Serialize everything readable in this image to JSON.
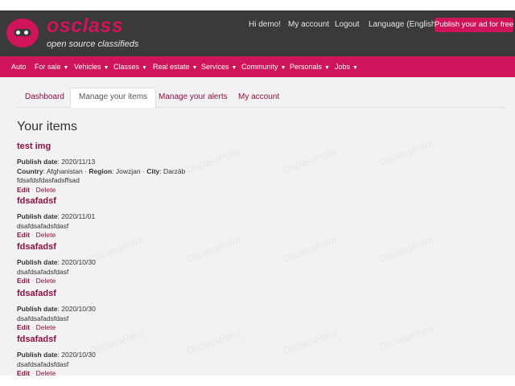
{
  "brand": {
    "name": "osclass",
    "tagline": "open source classifieds"
  },
  "top_links": {
    "greeting": "Hi demo!",
    "my_account": "My account",
    "logout": "Logout",
    "language": "Language (English)",
    "publish": "Publish your ad for free"
  },
  "nav": {
    "items": [
      {
        "label": "Auto",
        "dropdown": false
      },
      {
        "label": "For sale",
        "dropdown": true
      },
      {
        "label": "Vehicles",
        "dropdown": true
      },
      {
        "label": "Classes",
        "dropdown": true
      },
      {
        "label": "Real estate",
        "dropdown": true
      },
      {
        "label": "Services",
        "dropdown": true
      },
      {
        "label": "Community",
        "dropdown": true
      },
      {
        "label": "Personals",
        "dropdown": true
      },
      {
        "label": "Jobs",
        "dropdown": true
      }
    ]
  },
  "tabs": {
    "dashboard": "Dashboard",
    "manage_items": "Manage your items",
    "manage_alerts": "Manage your alerts",
    "my_account": "My account"
  },
  "page_title": "Your items",
  "labels": {
    "publish_date": "Publish date",
    "country": "Country",
    "region": "Region",
    "city": "City",
    "edit": "Edit",
    "delete": "Delete",
    "separator": "·"
  },
  "items": [
    {
      "title": "test img",
      "date": ": 2020/11/13",
      "country": ": Afghanistan",
      "region": ": Jowzjan",
      "city": ": Darzāb",
      "description": "fdsafdsfdasfadsffsad"
    },
    {
      "title": "fdsafadsf",
      "date": ": 2020/11/01",
      "description": "dsafdsafadsfdasf"
    },
    {
      "title": "fdsafadsf",
      "date": ": 2020/10/30",
      "description": "dsafdsafadsfdasf"
    },
    {
      "title": "fdsafadsf",
      "date": ": 2020/10/30",
      "description": "dsafdsafadsfdasf"
    },
    {
      "title": "fdsafadsf",
      "date": ": 2020/10/30",
      "description": "dsafdsafadsfdasf"
    }
  ],
  "watermark": "OsclassPoint",
  "colors": {
    "header_bg": "#3a3a3a",
    "accent": "#d0145a",
    "link": "#8a1040",
    "page_bg": "#f2f2f2"
  }
}
